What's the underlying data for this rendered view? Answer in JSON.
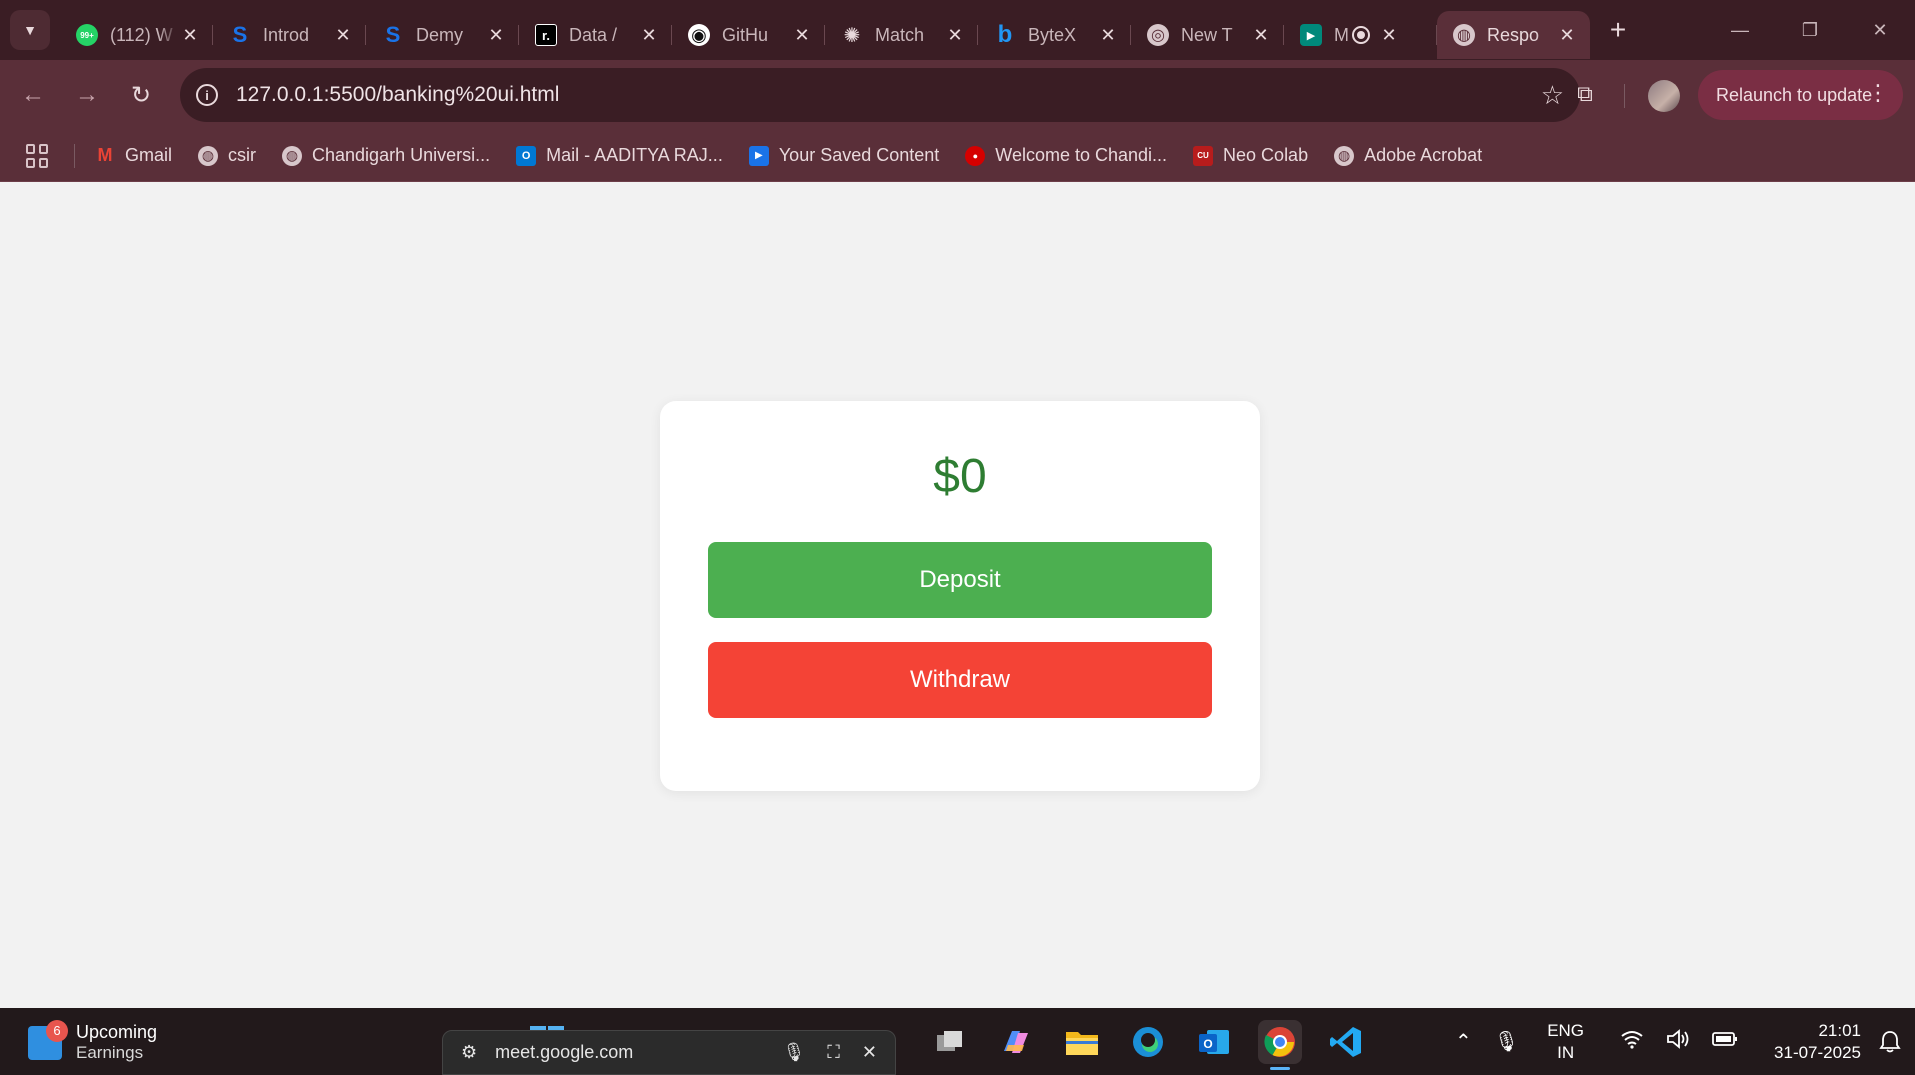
{
  "browser": {
    "tabs": [
      {
        "title": "(112) W",
        "icon": "whatsapp-icon",
        "icon_text": "99+",
        "color": "#25d366"
      },
      {
        "title": "Introd",
        "icon": "s-logo-icon",
        "icon_text": "S",
        "color": "#1a73e8"
      },
      {
        "title": "Demy",
        "icon": "s-logo-icon",
        "icon_text": "S",
        "color": "#1a73e8"
      },
      {
        "title": "Data /",
        "icon": "r-logo-icon",
        "icon_text": "r.",
        "color": "#000000"
      },
      {
        "title": "GitHu",
        "icon": "github-icon",
        "icon_text": "◉",
        "color": "#111111"
      },
      {
        "title": "Match",
        "icon": "openai-icon",
        "icon_text": "✺",
        "color": "#3a1d24"
      },
      {
        "title": "ByteX",
        "icon": "bytex-icon",
        "icon_text": "b",
        "color": "#1a73e8"
      },
      {
        "title": "New T",
        "icon": "chrome-icon",
        "icon_text": "◎",
        "color": "#6a5a5e"
      },
      {
        "title": "M",
        "icon": "google-meet-icon",
        "icon_text": "▶",
        "color": "#00897b"
      },
      {
        "title": "Respo",
        "icon": "globe-icon",
        "icon_text": "◍",
        "color": "#6a5a5e"
      }
    ],
    "url": "127.0.0.1:5500/banking%20ui.html",
    "relaunch_label": "Relaunch to update",
    "bookmarks": [
      {
        "label": "Gmail",
        "icon": "gmail-icon",
        "icon_text": "M",
        "color": "#ea4335"
      },
      {
        "label": "csir",
        "icon": "globe-icon",
        "icon_text": "◍",
        "color": "#6a5a5e"
      },
      {
        "label": "Chandigarh Universi...",
        "icon": "globe-icon",
        "icon_text": "◍",
        "color": "#6a5a5e"
      },
      {
        "label": "Mail - AADITYA RAJ...",
        "icon": "outlook-icon",
        "icon_text": "O",
        "color": "#0078d4"
      },
      {
        "label": "Your Saved Content",
        "icon": "video-icon",
        "icon_text": "▶",
        "color": "#1a73e8"
      },
      {
        "label": "Welcome to Chandi...",
        "icon": "cu-logo-icon",
        "icon_text": "●",
        "color": "#d50000"
      },
      {
        "label": "Neo Colab",
        "icon": "cu-badge-icon",
        "icon_text": "CU",
        "color": "#b71c1c"
      },
      {
        "label": "Adobe Acrobat",
        "icon": "globe-icon",
        "icon_text": "◍",
        "color": "#6a5a5e"
      }
    ]
  },
  "app": {
    "balance": "$0",
    "deposit_label": "Deposit",
    "withdraw_label": "Withdraw",
    "colors": {
      "balance": "#2e7d32",
      "deposit": "#4caf50",
      "withdraw": "#f44336"
    }
  },
  "taskbar": {
    "weather_badge": "6",
    "weather_title": "Upcoming",
    "weather_sub": "Earnings",
    "meet_url": "meet.google.com",
    "lang_top": "ENG",
    "lang_bottom": "IN",
    "time": "21:01",
    "date": "31-07-2025"
  }
}
